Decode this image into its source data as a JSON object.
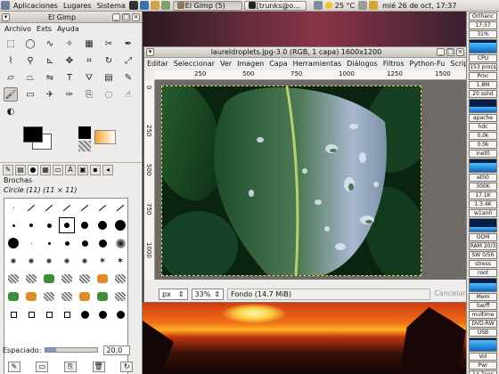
{
  "top_panel": {
    "menu": [
      "Aplicaciones",
      "Lugares",
      "Sistema"
    ],
    "tasks": [
      {
        "label": "El Gimp (5)",
        "active": true
      },
      {
        "label": "[trunks@o...",
        "active": false
      }
    ],
    "temperature": "25 °C",
    "clock": "mié 26 de oct, 17:37"
  },
  "toolbox": {
    "title": "El Gimp",
    "menu": [
      "Archivo",
      "Exts",
      "Ayuda"
    ],
    "tools": [
      {
        "name": "rect-select-icon",
        "glyph": "⬚"
      },
      {
        "name": "ellipse-select-icon",
        "glyph": "◯"
      },
      {
        "name": "free-select-icon",
        "glyph": "∿"
      },
      {
        "name": "fuzzy-select-icon",
        "glyph": "✧"
      },
      {
        "name": "color-select-icon",
        "glyph": "▦"
      },
      {
        "name": "scissors-icon",
        "glyph": "✂"
      },
      {
        "name": "paths-icon",
        "glyph": "✒"
      },
      {
        "name": "color-picker-icon",
        "glyph": "⌇"
      },
      {
        "name": "zoom-icon",
        "glyph": "⚲"
      },
      {
        "name": "measure-icon",
        "glyph": "⊾"
      },
      {
        "name": "move-icon",
        "glyph": "✥"
      },
      {
        "name": "crop-icon",
        "glyph": "⌗"
      },
      {
        "name": "rotate-icon",
        "glyph": "↻"
      },
      {
        "name": "scale-icon",
        "glyph": "⤢"
      },
      {
        "name": "shear-icon",
        "glyph": "▱"
      },
      {
        "name": "perspective-icon",
        "glyph": "⏢"
      },
      {
        "name": "flip-icon",
        "glyph": "⇋"
      },
      {
        "name": "text-icon",
        "glyph": "T"
      },
      {
        "name": "bucket-fill-icon",
        "glyph": "⛛"
      },
      {
        "name": "blend-icon",
        "glyph": "▤"
      },
      {
        "name": "pencil-icon",
        "glyph": "✎"
      },
      {
        "name": "paintbrush-icon",
        "glyph": "🖌",
        "selected": true
      },
      {
        "name": "eraser-icon",
        "glyph": "▭"
      },
      {
        "name": "airbrush-icon",
        "glyph": "✈"
      },
      {
        "name": "ink-icon",
        "glyph": "✑"
      },
      {
        "name": "clone-icon",
        "glyph": "⎘"
      },
      {
        "name": "convolve-icon",
        "glyph": "◌"
      },
      {
        "name": "smudge-icon",
        "glyph": "☝"
      },
      {
        "name": "dodge-burn-icon",
        "glyph": "◐"
      }
    ]
  },
  "brushes": {
    "title": "Brochas",
    "selected_brush": "Circle (11) (11 × 11)",
    "spacing_label": "Espaciado:",
    "spacing_value": "20,0",
    "spacing_fraction": 0.2
  },
  "image_window": {
    "title": "laureldroplets.jpg-3.0 (RGB, 1 capa) 1600x1200",
    "menu": [
      "Editar",
      "Seleccionar",
      "Ver",
      "Imagen",
      "Capa",
      "Herramientas",
      "Diálogos",
      "Filtros",
      "Python-Fu",
      "Script-Fu"
    ],
    "ruler_top": [
      "250",
      "500",
      "750",
      "1000",
      "1250",
      "1500"
    ],
    "ruler_left": [
      "0",
      "250",
      "500",
      "750",
      "1000"
    ],
    "unit": "px",
    "zoom": "33%",
    "status": "Fondo (14.7 MiB)",
    "cancel": "Cancelar"
  },
  "right_panel": {
    "items": [
      "Orthanc",
      "17:37",
      "31%",
      "CPU",
      "153 procs",
      "Proc",
      "1.8M",
      "20 sshd",
      "apache",
      "hdc",
      "0.0k",
      "0.0k",
      "inet0",
      "eth0",
      "300K",
      "17.1K",
      "1.3.4K",
      "w1an0",
      "OOM",
      "RAM 20/3",
      "SW 0/56",
      "stress",
      "root",
      "Mem",
      "Sw/ff",
      "multime",
      "DVD-RW",
      "USB",
      "Vol",
      "Pwr",
      "14.7nos"
    ]
  },
  "colors": {
    "panel": "#e4e0db",
    "selection_border": "#e2d86a",
    "leaf_dark": "#123a1c",
    "leaf_light": "#9fb4c8",
    "sunset": "#f07018"
  }
}
